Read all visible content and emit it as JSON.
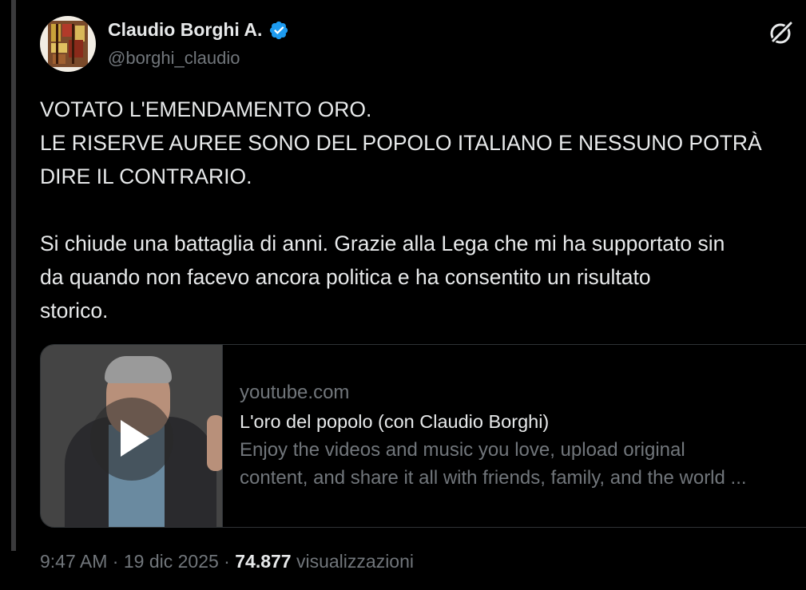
{
  "author": {
    "display_name": "Claudio Borghi A.",
    "handle": "@borghi_claudio",
    "verified": true,
    "verified_color": "#1d9bf0"
  },
  "icons": {
    "verified": "verified-badge-icon",
    "grok": "grok-icon",
    "play": "play-icon"
  },
  "tweet": {
    "lines": [
      "VOTATO L'EMENDAMENTO ORO.",
      "LE RISERVE AUREE SONO DEL POPOLO ITALIANO E NESSUNO POTRÀ",
      "DIRE IL CONTRARIO.",
      "",
      "Si chiude una battaglia di anni. Grazie alla Lega che mi ha supportato sin",
      "da quando non facevo ancora politica e ha consentito un risultato",
      "storico."
    ]
  },
  "card": {
    "domain": "youtube.com",
    "title": "L'oro del popolo (con Claudio Borghi)",
    "description_lines": [
      "Enjoy the videos and music you love, upload original",
      "content, and share it all with friends, family, and the world ..."
    ]
  },
  "meta": {
    "time": "9:47 AM",
    "separator": " · ",
    "date": "19 dic 2025",
    "views_count": "74.877",
    "views_label": "visualizzazioni"
  }
}
